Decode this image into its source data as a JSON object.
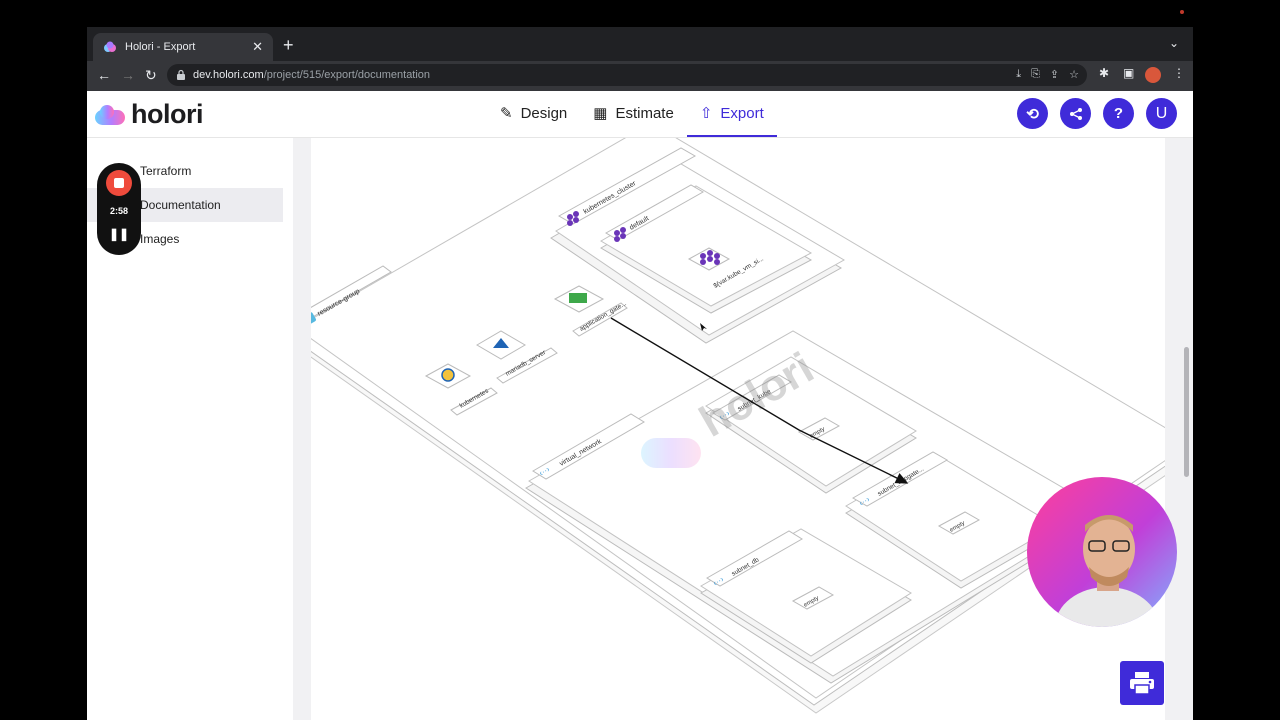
{
  "browser": {
    "tab_title": "Holori - Export",
    "url_host": "dev.holori.com",
    "url_path": "/project/515/export/documentation"
  },
  "app": {
    "logo_text": "holori",
    "nav": [
      {
        "label": "Design",
        "icon": "design-icon"
      },
      {
        "label": "Estimate",
        "icon": "calculator-icon"
      },
      {
        "label": "Export",
        "icon": "export-icon"
      }
    ],
    "active_tab": "Export",
    "user_initial": "U",
    "accent": "#3f2bd9"
  },
  "sidebar": {
    "items": [
      {
        "label": "Terraform"
      },
      {
        "label": "Documentation"
      },
      {
        "label": "Images"
      }
    ],
    "active": "Documentation"
  },
  "recorder": {
    "time": "2:58"
  },
  "diagram": {
    "watermark": "holori",
    "labels": {
      "resource_group": "resource-group",
      "kubernetes_cluster": "kubernetes_cluster",
      "default": "default",
      "vm": "${var.kube_vm_si...",
      "app_gateway": "application_gate...",
      "mariadb": "mariadb_server",
      "kubernetes": "kubernetes",
      "virtual_network": "virtual_network",
      "subnet_kube": "subnet_kube",
      "subnet_appgate": "subnet_appgate...",
      "subnet_db": "subnet_db",
      "empty_1": "empty",
      "empty_2": "empty",
      "empty_3": "empty"
    }
  }
}
